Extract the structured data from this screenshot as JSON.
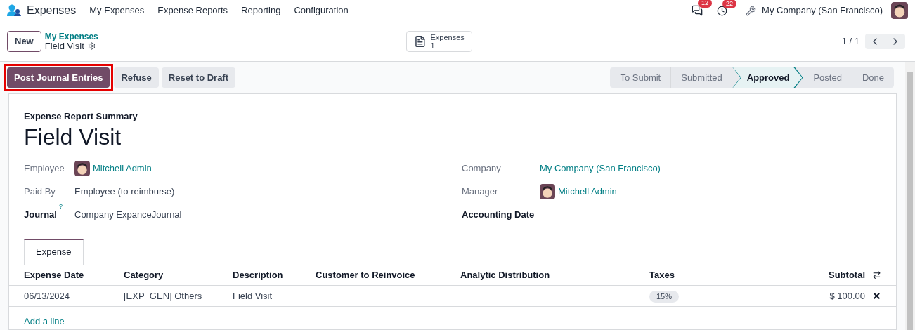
{
  "navbar": {
    "app_name": "Expenses",
    "menu": [
      "My Expenses",
      "Expense Reports",
      "Reporting",
      "Configuration"
    ],
    "messages_count": "12",
    "activities_count": "22",
    "company": "My Company (San Francisco)"
  },
  "control_panel": {
    "new_button": "New",
    "breadcrumb_parent": "My Expenses",
    "breadcrumb_current": "Field Visit",
    "smart_button": {
      "label": "Expenses",
      "count": "1"
    },
    "pager": "1 / 1"
  },
  "actions": [
    {
      "label": "Post Journal Entries",
      "primary": true,
      "highlighted": true
    },
    {
      "label": "Refuse",
      "primary": false,
      "highlighted": false
    },
    {
      "label": "Reset to Draft",
      "primary": false,
      "highlighted": false
    }
  ],
  "stages": [
    {
      "label": "To Submit",
      "selected": false
    },
    {
      "label": "Submitted",
      "selected": false
    },
    {
      "label": "Approved",
      "selected": true
    },
    {
      "label": "Posted",
      "selected": false
    },
    {
      "label": "Done",
      "selected": false
    }
  ],
  "sheet": {
    "subtitle": "Expense Report Summary",
    "title": "Field Visit",
    "left_fields": [
      {
        "label": "Employee",
        "value": "Mitchell Admin",
        "kind": "user",
        "bold": false
      },
      {
        "label": "Paid By",
        "value": "Employee (to reimburse)",
        "kind": "text",
        "bold": false
      },
      {
        "label": "Journal",
        "help": "?",
        "value": "Company ExpanceJournal",
        "kind": "text",
        "bold": true
      }
    ],
    "right_fields": [
      {
        "label": "Company",
        "value": "My Company (San Francisco)",
        "kind": "link",
        "bold": false
      },
      {
        "label": "Manager",
        "value": "Mitchell Admin",
        "kind": "user",
        "bold": false
      },
      {
        "label": "Accounting Date",
        "bold": true
      }
    ],
    "tabs": [
      {
        "label": "Expense",
        "selected": true
      }
    ],
    "table": {
      "columns": [
        "Expense Date",
        "Category",
        "Description",
        "Customer to Reinvoice",
        "Analytic Distribution",
        "Taxes",
        "Subtotal"
      ],
      "rows": [
        {
          "date": "06/13/2024",
          "category": "[EXP_GEN] Others",
          "description": "Field Visit",
          "taxes": "15%",
          "subtotal": "$ 100.00"
        }
      ],
      "add_line": "Add a line"
    }
  }
}
